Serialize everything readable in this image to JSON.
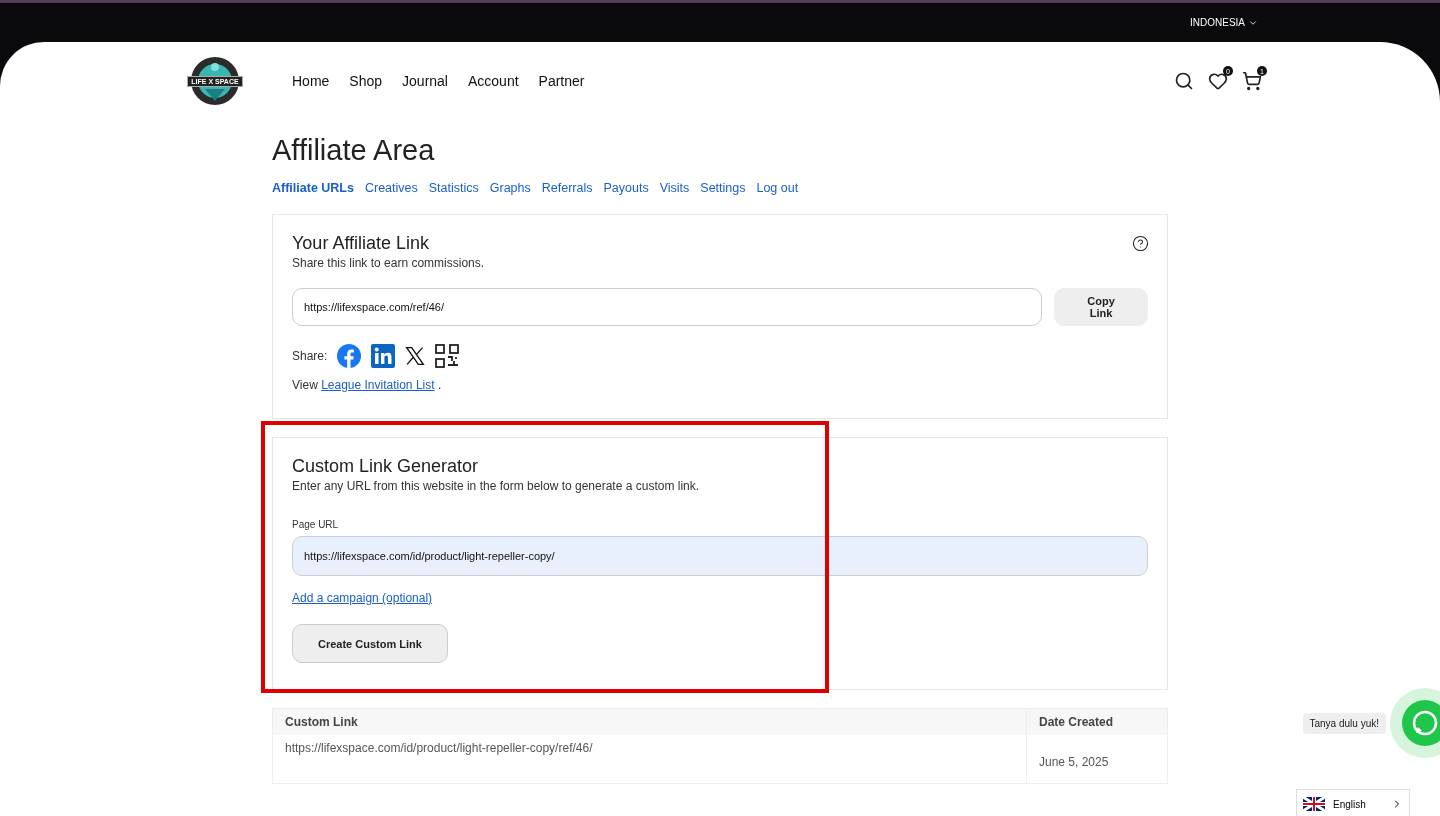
{
  "top_bar": {
    "region": "INDONESIA"
  },
  "header": {
    "logo_text": "LIFE X SPACE",
    "nav": [
      {
        "label": "Home"
      },
      {
        "label": "Shop"
      },
      {
        "label": "Journal"
      },
      {
        "label": "Account"
      },
      {
        "label": "Partner"
      }
    ],
    "wishlist_count": "0",
    "cart_count": "1"
  },
  "page_title": "Affiliate Area",
  "tabs": [
    {
      "label": "Affiliate URLs",
      "selected": true
    },
    {
      "label": "Creatives",
      "selected": false
    },
    {
      "label": "Statistics",
      "selected": false
    },
    {
      "label": "Graphs",
      "selected": false
    },
    {
      "label": "Referrals",
      "selected": false
    },
    {
      "label": "Payouts",
      "selected": false
    },
    {
      "label": "Visits",
      "selected": false
    },
    {
      "label": "Settings",
      "selected": false
    },
    {
      "label": "Log out",
      "selected": false
    }
  ],
  "affiliate_link": {
    "title": "Your Affiliate Link",
    "subtitle": "Share this link to earn commissions.",
    "value": "https://lifexspace.com/ref/46/",
    "copy_button": "Copy Link",
    "share_label": "Share:",
    "share": [
      {
        "kind": "facebook"
      },
      {
        "kind": "linkedin"
      },
      {
        "kind": "x"
      },
      {
        "kind": "qr"
      }
    ],
    "view_prefix": "View",
    "view_link": "League Invitation List",
    "view_suffix": "."
  },
  "custom_link_generator": {
    "title": "Custom Link Generator",
    "subtitle": "Enter any URL from this website in the form below to generate a custom link.",
    "field_label": "Page URL",
    "value": "https://lifexspace.com/id/product/light-repeller-copy/",
    "campaign_link": "Add a campaign (optional)",
    "button": "Create Custom Link",
    "highlighted": true
  },
  "table": {
    "columns": [
      "Custom Link",
      "Date Created"
    ],
    "rows": [
      [
        "https://lifexspace.com/id/product/light-repeller-copy/ref/46/",
        "June 5, 2025"
      ]
    ]
  },
  "chat_widget": {
    "tooltip": "Tanya dulu yuk!"
  },
  "language": {
    "label": "English"
  }
}
